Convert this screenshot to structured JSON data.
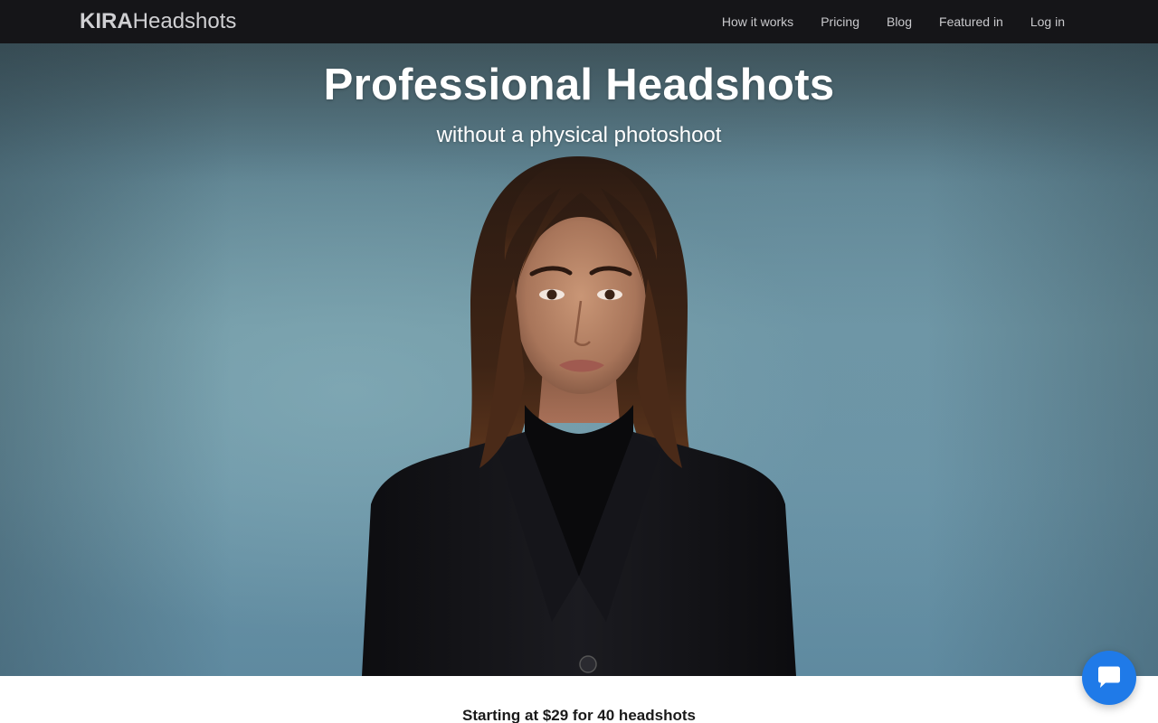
{
  "brand": {
    "bold": "KIRA",
    "light": "Headshots"
  },
  "nav": {
    "items": [
      {
        "label": "How it works"
      },
      {
        "label": "Pricing"
      },
      {
        "label": "Blog"
      },
      {
        "label": "Featured in"
      },
      {
        "label": "Log in"
      }
    ]
  },
  "hero": {
    "title": "Professional Headshots",
    "subtitle": "without a physical photoshoot"
  },
  "pricing": {
    "text": "Starting at $29 for 40 headshots"
  },
  "chat": {
    "icon": "chat-bubble-icon"
  },
  "colors": {
    "navbar_bg": "#151518",
    "chat_button": "#1f7ae8",
    "hero_bg": "#6e96a3"
  }
}
